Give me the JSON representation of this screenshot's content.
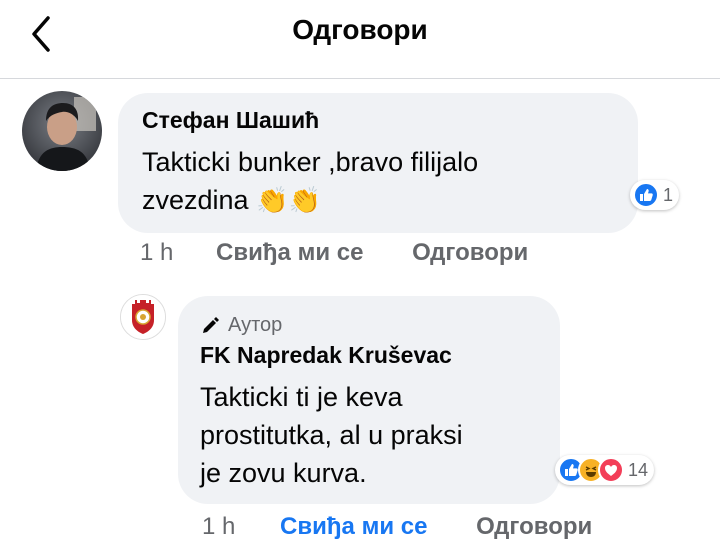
{
  "header": {
    "title": "Одговори",
    "back_icon": "chevron-left-icon"
  },
  "comment": {
    "author": "Стефан Шашић",
    "text_line1": "Takticki bunker ,bravo filijalo",
    "text_line2": "zvezdina",
    "emoji": "👏👏",
    "reactions": {
      "icons": [
        "like-icon"
      ],
      "count": "1"
    },
    "time": "1 h",
    "like_label": "Свиђа ми се",
    "reply_label": "Одговори"
  },
  "reply": {
    "author_badge": "Аутор",
    "author": "FK Napredak Kruševac",
    "text_line1": "Takticki ti je keva",
    "text_line2": "prostitutka, al u praksi",
    "text_line3": "je zovu kurva.",
    "reactions": {
      "icons": [
        "like-icon",
        "haha-icon",
        "love-icon"
      ],
      "count": "14"
    },
    "time": "1 h",
    "like_label": "Свиђа ми се",
    "reply_label": "Одговори",
    "liked": true
  },
  "colors": {
    "accent": "#1877f2",
    "bubble": "#f0f2f5",
    "secondary_text": "#65676b",
    "love": "#f33e58",
    "haha": "#f7b125"
  }
}
